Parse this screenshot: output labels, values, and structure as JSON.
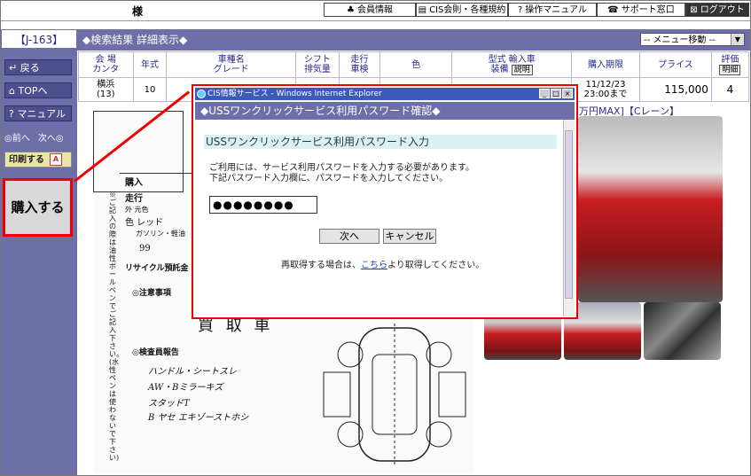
{
  "topbar": {
    "sama": "様",
    "buttons": [
      {
        "icon": "club-icon",
        "glyph": "♣",
        "label": "会員情報"
      },
      {
        "icon": "document-icon",
        "glyph": "▤",
        "label": "CIS会則・各種規約"
      },
      {
        "icon": "question-icon",
        "glyph": "?",
        "label": "操作マニュアル"
      },
      {
        "icon": "phone-icon",
        "glyph": "☎",
        "label": "サポート窓口"
      },
      {
        "icon": "close-box-icon",
        "glyph": "⊠",
        "label": "ログアウト"
      }
    ]
  },
  "sidebar": {
    "code": "【J-163】",
    "back": "↵ 戻る",
    "top": "⌂ TOPへ",
    "manual": "? マニュアル",
    "prev": "◎前へ",
    "next": "次へ◎",
    "print": "印刷する",
    "buy": "購入する"
  },
  "titlebar": {
    "title": "◆検索結果 詳細表示◆",
    "menu": "-- メニュー移動 --"
  },
  "table": {
    "headers": [
      "会 場\nカンタ",
      "年式",
      "車種名\nグレード",
      "シフト\n排気量",
      "走行\n車検",
      "色",
      "型式 輸入車\n装備",
      "購入期限",
      "プライス",
      "評価"
    ],
    "spec_button": "説明",
    "eval_button": "明細",
    "row": {
      "venue": "横浜",
      "lot": "(13)",
      "year": "10",
      "deadline": "11/12/23\n23:00まで",
      "price": "115,000",
      "score": "4"
    }
  },
  "crane": "万円MAX]【Cレーン】",
  "sheet_text": {
    "kounyu": "購入",
    "soukou": "走行",
    "gaisou": "外 元色",
    "iro": "色 レッド",
    "gasoline": "ガソリン・軽油",
    "nenpi": "99",
    "recycle": "リサイクル預託金",
    "chui": "◎注意事項",
    "kaitori": "買 取 車",
    "kensa": "◎検査員報告",
    "hw1": "ハンドル・シートスレ",
    "hw2": "AW・Bミラーキズ",
    "hw3": "スタッドT",
    "hw4": "B ヤセ エキゾーストホシ",
    "side_note": "※ご記入の際は油性ボールペンでご記入下さい。(水性ペンは使わないで下さい)"
  },
  "dialog": {
    "window_title": "CIS情報サービス - Windows Internet Explorer",
    "heading": "◆USSワンクリックサービス利用パスワード確認◆",
    "subheading": "USSワンクリックサービス利用パスワード入力",
    "message_line1": "ご利用には、サービス利用パスワードを入力する必要があります。",
    "message_line2": "下記パスワード入力欄に、パスワードを入力してください。",
    "password_value": "●●●●●●●●",
    "next_label": "次へ",
    "cancel_label": "キャンセル",
    "note_before": "再取得する場合は、",
    "note_link": "こちら",
    "note_after": "より取得してください。"
  },
  "colors": {
    "sidebar": "#6e6fa8",
    "highlight": "#e00000",
    "ie_titlebar": "#3a5bb8",
    "car": "#c81e22"
  }
}
